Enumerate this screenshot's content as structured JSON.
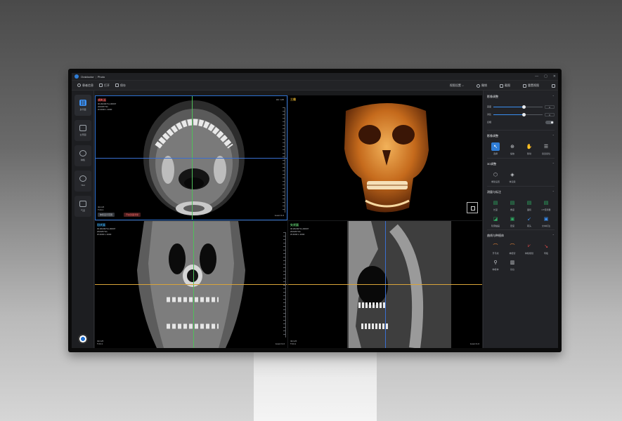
{
  "app": {
    "title_left": "Oraldoctor",
    "title_sep": "|",
    "title_right": "Photo",
    "win_controls": [
      "—",
      "▢",
      "✕"
    ]
  },
  "toolbar": {
    "items": [
      {
        "label": "患者信息",
        "icon": "user-icon"
      },
      {
        "label": "打开",
        "icon": "folder-icon"
      },
      {
        "label": "保存",
        "icon": "save-icon"
      }
    ],
    "right_items": [
      {
        "label": "视图设置 ⌵",
        "icon": "view-icon"
      },
      {
        "label": "撤销",
        "icon": "undo-icon"
      },
      {
        "label": "截图",
        "icon": "screenshot-icon"
      },
      {
        "label": "重置视图",
        "icon": "reset-icon"
      },
      {
        "label": "",
        "icon": "more-icon"
      }
    ]
  },
  "rail": {
    "items": [
      {
        "label": "多平面",
        "icon": "mpr-grid-icon",
        "active": true
      },
      {
        "label": "全景图",
        "icon": "panorama-icon",
        "active": false
      },
      {
        "label": "种植",
        "icon": "implant-icon",
        "active": false
      },
      {
        "label": "TMJ",
        "icon": "tmj-icon",
        "active": false
      },
      {
        "label": "气道",
        "icon": "airway-icon",
        "active": false
      }
    ]
  },
  "viewports": {
    "axial": {
      "title": "横断面",
      "title_color": "#e85a5a",
      "meta": [
        "ID:20230711-00007",
        "2023/07/11",
        "W:4000 L:1000"
      ],
      "foot": [
        "4mm/2",
        "T:24.1"
      ],
      "zoom": "zoom=1.0",
      "tr": "HU: 125",
      "btn1": "体积显示范围",
      "btn2": "开启剖面测量"
    },
    "three_d": {
      "title": "三维",
      "title_color": "#e0b030"
    },
    "coronal": {
      "title": "冠状面",
      "title_color": "#3aa4e8",
      "meta": [
        "ID:20230711-00007",
        "2023/07/11",
        "W:4000 L:1000"
      ],
      "foot": [
        "4mm/2",
        "T:24.1"
      ],
      "zoom": "zoom=1.0"
    },
    "sagittal": {
      "title": "矢状面",
      "title_color": "#5bc46a",
      "meta": [
        "ID:20230711-00007",
        "2023/07/11",
        "W:4000 L:1000"
      ],
      "foot": [
        "4mm/2",
        "T:24.1"
      ],
      "zoom": "zoom=1.0"
    }
  },
  "panel": {
    "image_adjust": {
      "title": "影像调整",
      "rows": [
        {
          "label": "亮度",
          "value": "0"
        },
        {
          "label": "对比",
          "value": "0"
        }
      ],
      "toggle_label": "反相"
    },
    "image_tools": {
      "title": "影像调整",
      "tools": [
        {
          "label": "选择",
          "icon": "pointer-icon",
          "glyph": "↖",
          "style": "sel"
        },
        {
          "label": "缩放",
          "icon": "zoom-icon",
          "glyph": "⊕",
          "style": "gray"
        },
        {
          "label": "移动",
          "icon": "pan-icon",
          "glyph": "✋",
          "style": "gray"
        },
        {
          "label": "窗宽窗位",
          "icon": "list-icon",
          "glyph": "☰",
          "style": "gray"
        }
      ]
    },
    "threed": {
      "title": "3D调整",
      "tools": [
        {
          "label": "重建设置",
          "icon": "reconstruct-icon",
          "glyph": "⬡",
          "style": "gray"
        },
        {
          "label": "体渲染",
          "icon": "volume-icon",
          "glyph": "◈",
          "style": "gray"
        }
      ]
    },
    "measure": {
      "title": "测量与标注",
      "tools": [
        {
          "label": "长度",
          "icon": "length-icon",
          "glyph": "▤",
          "style": "green"
        },
        {
          "label": "角度",
          "icon": "angle-icon",
          "glyph": "▤",
          "style": "green"
        },
        {
          "label": "面积",
          "icon": "area-icon",
          "glyph": "▤",
          "style": "green"
        },
        {
          "label": "CT值测量",
          "icon": "ct-icon",
          "glyph": "▤",
          "style": "green"
        },
        {
          "label": "轮廓描画",
          "icon": "contour-icon",
          "glyph": "◪",
          "style": "green"
        },
        {
          "label": "密度",
          "icon": "density-icon",
          "glyph": "▣",
          "style": "green"
        },
        {
          "label": "箭头",
          "icon": "arrow-icon",
          "glyph": "↙",
          "style": "blue"
        },
        {
          "label": "文本标注",
          "icon": "text-icon",
          "glyph": "▣",
          "style": "blue"
        }
      ]
    },
    "implant": {
      "title": "曲线与种植体",
      "tools": [
        {
          "label": "牙弓线",
          "icon": "arch-icon",
          "glyph": "⌒",
          "style": "orange"
        },
        {
          "label": "神经管",
          "icon": "nerve-icon",
          "glyph": "⌒",
          "style": "orange"
        },
        {
          "label": "种植规划",
          "icon": "plan-icon",
          "glyph": "⩗",
          "style": "red"
        },
        {
          "label": "导板",
          "icon": "guide-icon",
          "glyph": "↘",
          "style": "red"
        },
        {
          "label": "种植体",
          "icon": "implant-tool-icon",
          "glyph": "⚲",
          "style": "gray"
        },
        {
          "label": "基台",
          "icon": "abutment-icon",
          "glyph": "▥",
          "style": "gray"
        }
      ]
    }
  },
  "colors": {
    "accent": "#2f7dd6",
    "axial_line": "#3a8ef0",
    "guide_green": "#4fbf5a",
    "guide_orange": "#d9a43a"
  }
}
